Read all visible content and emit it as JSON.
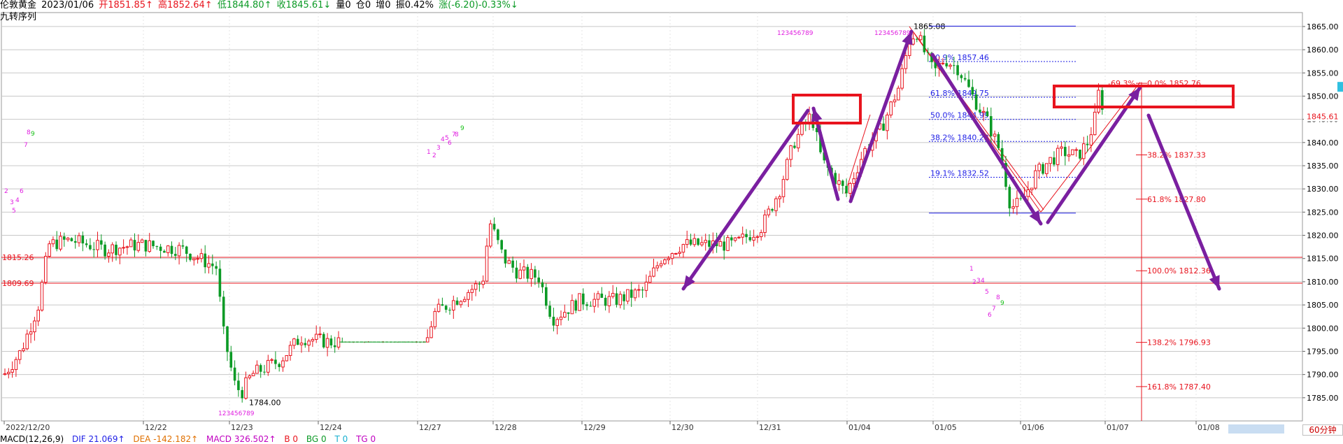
{
  "header": {
    "instrument": "伦敦黄金",
    "date": "2023/01/06",
    "open": "开1851.85↑",
    "high": "高1852.64↑",
    "low": "低1844.80↑",
    "close": "收1845.61↓",
    "volume": "量0",
    "open_interest": "仓0",
    "oi_change": "增0",
    "amplitude": "振0.42%",
    "change": "涨(-6.20)-0.33%↓"
  },
  "subtitle": "九转序列",
  "timeframe": "60分钟",
  "macd": {
    "name": "MACD(12,26,9)",
    "dif": "DIF 21.069↑",
    "dea": "DEA -142.182↑",
    "macd": "MACD 326.502↑",
    "b": "B 0",
    "bg": "BG 0",
    "t": "T 0",
    "tg": "TG 0"
  },
  "colors": {
    "up": "#e8141e",
    "down": "#0b9a25",
    "fib_blue": "#1e1ee6",
    "fib_red": "#e8141e",
    "arrow": "#7a1fa0",
    "box": "#e8141e",
    "grid": "#c8c8c8",
    "magenta": "#e020e0",
    "green_seq": "#18c018"
  },
  "chart_data": {
    "type": "candlestick",
    "ylim": [
      1780,
      1868
    ],
    "y_ticks": [
      "1865.00",
      "1860.00",
      "1855.00",
      "1850.00",
      "1845.00",
      "1840.00",
      "1835.00",
      "1830.00",
      "1825.00",
      "1820.00",
      "1815.00",
      "1810.00",
      "1805.00",
      "1800.00",
      "1795.00",
      "1790.00",
      "1785.00"
    ],
    "x_labels": [
      "2022/12/20",
      "12/22",
      "12/23",
      "12/24",
      "12/27",
      "12/28",
      "12/29",
      "12/30",
      "12/31",
      "01/04",
      "01/05",
      "01/06",
      "01/07",
      "01/08"
    ],
    "current_price": "1845.61",
    "horizontal_levels": [
      {
        "label": "1815.26",
        "value": 1815.26
      },
      {
        "label": "1809.69",
        "value": 1809.69
      }
    ],
    "annotated_prices": [
      {
        "label": "1784.00",
        "value": 1784.0
      },
      {
        "label": "1865.08",
        "value": 1865.08
      }
    ],
    "fib_retracement_blue": [
      {
        "label": "80.9% 1857.46",
        "value": 1857.46
      },
      {
        "label": "61.8% 1849.75",
        "value": 1849.75
      },
      {
        "label": "50.0% 1844.99",
        "value": 1844.99
      },
      {
        "label": "38.2% 1840.23",
        "value": 1840.23
      },
      {
        "label": "19.1% 1832.52",
        "value": 1832.52
      }
    ],
    "fib_projection_red": [
      {
        "label": "-69.3%",
        "value": 1852.76
      },
      {
        "label": "0.0% 1852.76",
        "value": 1852.76
      },
      {
        "label": "38.2% 1837.33",
        "value": 1837.33
      },
      {
        "label": "61.8% 1827.80",
        "value": 1827.8
      },
      {
        "label": "100.0% 1812.36",
        "value": 1812.36
      },
      {
        "label": "138.2% 1796.93",
        "value": 1796.93
      },
      {
        "label": "161.8% 1787.40",
        "value": 1787.4
      }
    ],
    "sequence_labels": [
      "2",
      "3",
      "4",
      "5",
      "6",
      "7",
      "8",
      "9",
      "1",
      "2",
      "3",
      "4",
      "5",
      "6",
      "7",
      "8",
      "9",
      "123456789",
      "123456789",
      "123456789",
      "1",
      "2",
      "3",
      "4",
      "5",
      "6",
      "7",
      "8",
      "9"
    ],
    "series": [
      {
        "name": "candles",
        "ohlc": []
      }
    ]
  }
}
